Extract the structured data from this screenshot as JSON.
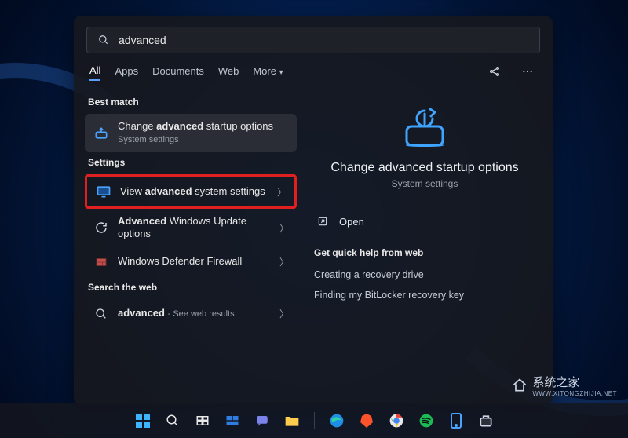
{
  "search": {
    "query": "advanced"
  },
  "tabs": {
    "all": "All",
    "apps": "Apps",
    "documents": "Documents",
    "web": "Web",
    "more": "More"
  },
  "sections": {
    "best_match": "Best match",
    "settings": "Settings",
    "search_web": "Search the web"
  },
  "results": {
    "best_match": {
      "title_pre": "Change ",
      "title_bold": "advanced",
      "title_post": " startup options",
      "subtitle": "System settings"
    },
    "settings_0": {
      "title_pre": "View ",
      "title_bold": "advanced",
      "title_post": " system settings"
    },
    "settings_1": {
      "title_bold": "Advanced",
      "title_post": " Windows Update options"
    },
    "settings_2": {
      "title": "Windows Defender Firewall"
    },
    "web_0": {
      "title_bold": "advanced",
      "title_post": " - See web results"
    }
  },
  "preview": {
    "title": "Change advanced startup options",
    "subtitle": "System settings",
    "open": "Open",
    "quick_help": "Get quick help from web",
    "link1": "Creating a recovery drive",
    "link2": "Finding my BitLocker recovery key"
  },
  "watermark": {
    "text": "系统之家",
    "url": "WWW.XITONGZHIJIA.NET"
  }
}
